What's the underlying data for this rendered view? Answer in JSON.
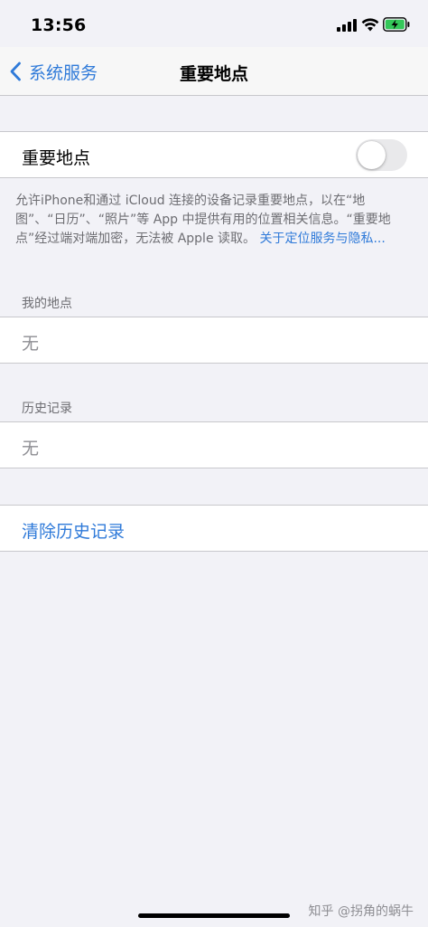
{
  "status_bar": {
    "time": "13:56",
    "icons": [
      "cellular-signal-icon",
      "wifi-icon",
      "battery-charging-icon"
    ],
    "battery_color": "#34c759"
  },
  "nav": {
    "back_label": "系统服务",
    "title": "重要地点"
  },
  "significant_locations": {
    "toggle_label": "重要地点",
    "toggle_on": false,
    "description": "允许iPhone和通过 iCloud 连接的设备记录重要地点，以在“地图”、“日历”、“照片”等 App 中提供有用的位置相关信息。“重要地点”经过端对端加密，无法被 Apple 读取。",
    "link": "关于定位服务与隐私..."
  },
  "my_places": {
    "header": "我的地点",
    "empty": "无"
  },
  "history": {
    "header": "历史记录",
    "empty": "无"
  },
  "actions": {
    "clear_history": "清除历史记录"
  },
  "watermark": "知乎 @拐角的蜗牛",
  "colors": {
    "accent": "#2f7ad9",
    "background": "#f2f2f7",
    "secondary_text": "#6d6d72"
  }
}
